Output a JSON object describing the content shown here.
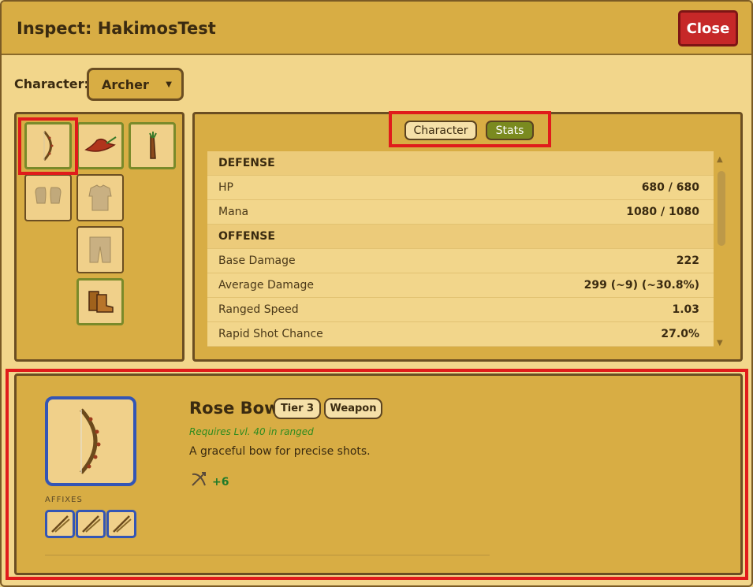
{
  "window": {
    "title": "Inspect: HakimosTest",
    "close_label": "Close"
  },
  "character": {
    "label": "Character:",
    "selected": "Archer"
  },
  "tabs": [
    {
      "label": "Character",
      "active": false
    },
    {
      "label": "Stats",
      "active": true
    }
  ],
  "stats": {
    "sections": [
      {
        "title": "DEFENSE",
        "rows": [
          {
            "label": "HP",
            "value": "680 / 680"
          },
          {
            "label": "Mana",
            "value": "1080 / 1080"
          }
        ]
      },
      {
        "title": "OFFENSE",
        "rows": [
          {
            "label": "Base Damage",
            "value": "222"
          },
          {
            "label": "Average Damage",
            "value": "299 (~9) (~30.8%)"
          },
          {
            "label": "Ranged Speed",
            "value": "1.03"
          },
          {
            "label": "Rapid Shot Chance",
            "value": "27.0%"
          }
        ]
      }
    ]
  },
  "equipment": {
    "slots": [
      {
        "name": "bow-icon",
        "equipped": true,
        "selected": true
      },
      {
        "name": "hat-icon",
        "equipped": true
      },
      {
        "name": "quiver-icon",
        "equipped": true
      },
      {
        "name": "gloves-icon",
        "equipped": false
      },
      {
        "name": "chest-armor-icon",
        "equipped": false
      },
      {
        "name": "pants-icon",
        "equipped": false
      },
      {
        "name": "boots-icon",
        "equipped": true
      }
    ]
  },
  "item": {
    "name": "Rose Bow",
    "badges": [
      "Tier 3",
      "Weapon"
    ],
    "requirement": "Requires Lvl. 40 in ranged",
    "description": "A graceful bow for precise shots.",
    "bonus_icon": "ranged-bow-icon",
    "bonus_value": "+6",
    "affixes_label": "AFFIXES",
    "affixes": [
      "arrow-affix-icon",
      "arrow-affix-icon",
      "arrow-affix-icon"
    ]
  },
  "colors": {
    "accent_blue": "#3355b5",
    "close_red": "#c62828",
    "active_tab": "#7a8a1f",
    "highlight": "#e01b1b",
    "requirement_green": "#2e8b1e"
  }
}
